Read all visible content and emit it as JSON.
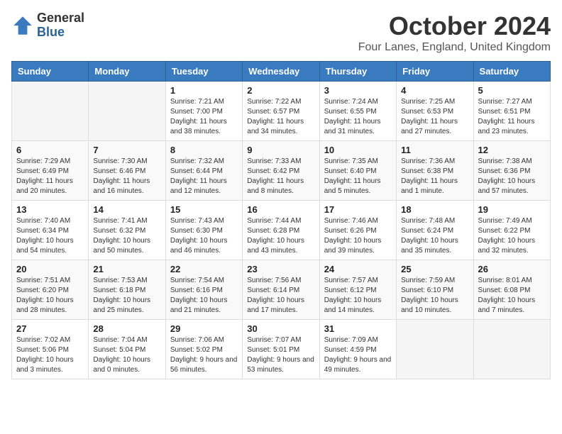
{
  "header": {
    "logo_general": "General",
    "logo_blue": "Blue",
    "month_title": "October 2024",
    "location": "Four Lanes, England, United Kingdom"
  },
  "weekdays": [
    "Sunday",
    "Monday",
    "Tuesday",
    "Wednesday",
    "Thursday",
    "Friday",
    "Saturday"
  ],
  "weeks": [
    [
      {
        "day": "",
        "info": ""
      },
      {
        "day": "",
        "info": ""
      },
      {
        "day": "1",
        "info": "Sunrise: 7:21 AM\nSunset: 7:00 PM\nDaylight: 11 hours and 38 minutes."
      },
      {
        "day": "2",
        "info": "Sunrise: 7:22 AM\nSunset: 6:57 PM\nDaylight: 11 hours and 34 minutes."
      },
      {
        "day": "3",
        "info": "Sunrise: 7:24 AM\nSunset: 6:55 PM\nDaylight: 11 hours and 31 minutes."
      },
      {
        "day": "4",
        "info": "Sunrise: 7:25 AM\nSunset: 6:53 PM\nDaylight: 11 hours and 27 minutes."
      },
      {
        "day": "5",
        "info": "Sunrise: 7:27 AM\nSunset: 6:51 PM\nDaylight: 11 hours and 23 minutes."
      }
    ],
    [
      {
        "day": "6",
        "info": "Sunrise: 7:29 AM\nSunset: 6:49 PM\nDaylight: 11 hours and 20 minutes."
      },
      {
        "day": "7",
        "info": "Sunrise: 7:30 AM\nSunset: 6:46 PM\nDaylight: 11 hours and 16 minutes."
      },
      {
        "day": "8",
        "info": "Sunrise: 7:32 AM\nSunset: 6:44 PM\nDaylight: 11 hours and 12 minutes."
      },
      {
        "day": "9",
        "info": "Sunrise: 7:33 AM\nSunset: 6:42 PM\nDaylight: 11 hours and 8 minutes."
      },
      {
        "day": "10",
        "info": "Sunrise: 7:35 AM\nSunset: 6:40 PM\nDaylight: 11 hours and 5 minutes."
      },
      {
        "day": "11",
        "info": "Sunrise: 7:36 AM\nSunset: 6:38 PM\nDaylight: 11 hours and 1 minute."
      },
      {
        "day": "12",
        "info": "Sunrise: 7:38 AM\nSunset: 6:36 PM\nDaylight: 10 hours and 57 minutes."
      }
    ],
    [
      {
        "day": "13",
        "info": "Sunrise: 7:40 AM\nSunset: 6:34 PM\nDaylight: 10 hours and 54 minutes."
      },
      {
        "day": "14",
        "info": "Sunrise: 7:41 AM\nSunset: 6:32 PM\nDaylight: 10 hours and 50 minutes."
      },
      {
        "day": "15",
        "info": "Sunrise: 7:43 AM\nSunset: 6:30 PM\nDaylight: 10 hours and 46 minutes."
      },
      {
        "day": "16",
        "info": "Sunrise: 7:44 AM\nSunset: 6:28 PM\nDaylight: 10 hours and 43 minutes."
      },
      {
        "day": "17",
        "info": "Sunrise: 7:46 AM\nSunset: 6:26 PM\nDaylight: 10 hours and 39 minutes."
      },
      {
        "day": "18",
        "info": "Sunrise: 7:48 AM\nSunset: 6:24 PM\nDaylight: 10 hours and 35 minutes."
      },
      {
        "day": "19",
        "info": "Sunrise: 7:49 AM\nSunset: 6:22 PM\nDaylight: 10 hours and 32 minutes."
      }
    ],
    [
      {
        "day": "20",
        "info": "Sunrise: 7:51 AM\nSunset: 6:20 PM\nDaylight: 10 hours and 28 minutes."
      },
      {
        "day": "21",
        "info": "Sunrise: 7:53 AM\nSunset: 6:18 PM\nDaylight: 10 hours and 25 minutes."
      },
      {
        "day": "22",
        "info": "Sunrise: 7:54 AM\nSunset: 6:16 PM\nDaylight: 10 hours and 21 minutes."
      },
      {
        "day": "23",
        "info": "Sunrise: 7:56 AM\nSunset: 6:14 PM\nDaylight: 10 hours and 17 minutes."
      },
      {
        "day": "24",
        "info": "Sunrise: 7:57 AM\nSunset: 6:12 PM\nDaylight: 10 hours and 14 minutes."
      },
      {
        "day": "25",
        "info": "Sunrise: 7:59 AM\nSunset: 6:10 PM\nDaylight: 10 hours and 10 minutes."
      },
      {
        "day": "26",
        "info": "Sunrise: 8:01 AM\nSunset: 6:08 PM\nDaylight: 10 hours and 7 minutes."
      }
    ],
    [
      {
        "day": "27",
        "info": "Sunrise: 7:02 AM\nSunset: 5:06 PM\nDaylight: 10 hours and 3 minutes."
      },
      {
        "day": "28",
        "info": "Sunrise: 7:04 AM\nSunset: 5:04 PM\nDaylight: 10 hours and 0 minutes."
      },
      {
        "day": "29",
        "info": "Sunrise: 7:06 AM\nSunset: 5:02 PM\nDaylight: 9 hours and 56 minutes."
      },
      {
        "day": "30",
        "info": "Sunrise: 7:07 AM\nSunset: 5:01 PM\nDaylight: 9 hours and 53 minutes."
      },
      {
        "day": "31",
        "info": "Sunrise: 7:09 AM\nSunset: 4:59 PM\nDaylight: 9 hours and 49 minutes."
      },
      {
        "day": "",
        "info": ""
      },
      {
        "day": "",
        "info": ""
      }
    ]
  ]
}
